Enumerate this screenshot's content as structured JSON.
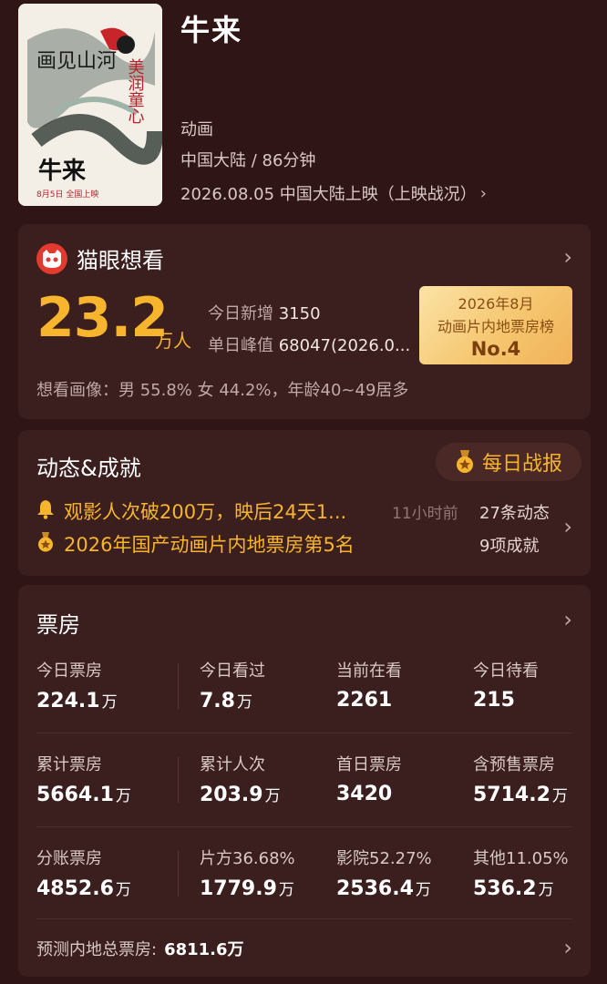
{
  "movie": {
    "title": "牛来",
    "genre": "动画",
    "region_duration": "中国大陆 / 86分钟",
    "release": "2026.08.05 中国大陆上映（上映战况）",
    "poster": {
      "calligraphy_left": "画见山河",
      "calligraphy_right": "美润童心",
      "title": "牛来",
      "date": "8月5日 全国上映"
    }
  },
  "want": {
    "title": "猫眼想看",
    "count": "23.2",
    "unit": "万人",
    "today_label": "今日新增",
    "today_value": "3150",
    "peak_label": "单日峰值",
    "peak_value": "68047(2026.0...",
    "rank": {
      "line1": "2026年8月",
      "line2": "动画片内地票房榜",
      "line3": "No.4"
    },
    "portrait": "想看画像：男 55.8%  女 44.2%，年龄40~49居多"
  },
  "dynamics": {
    "title": "动态&成就",
    "daily_button": "每日战报",
    "item1": "观影人次破200万，映后24天1...",
    "item1_time": "11小时前",
    "item1_count": "27条动态",
    "item2": "2026年国产动画片内地票房第5名",
    "item2_count": "9项成就"
  },
  "boxoffice": {
    "title": "票房",
    "rows": [
      [
        {
          "label": "今日票房",
          "value": "224.1",
          "unit": "万"
        },
        {
          "label": "今日看过",
          "value": "7.8",
          "unit": "万"
        },
        {
          "label": "当前在看",
          "value": "2261",
          "unit": ""
        },
        {
          "label": "今日待看",
          "value": "215",
          "unit": ""
        }
      ],
      [
        {
          "label": "累计票房",
          "value": "5664.1",
          "unit": "万"
        },
        {
          "label": "累计人次",
          "value": "203.9",
          "unit": "万"
        },
        {
          "label": "首日票房",
          "value": "3420",
          "unit": ""
        },
        {
          "label": "含预售票房",
          "value": "5714.2",
          "unit": "万"
        }
      ],
      [
        {
          "label": "分账票房",
          "value": "4852.6",
          "unit": "万"
        },
        {
          "label": "片方36.68%",
          "value": "1779.9",
          "unit": "万"
        },
        {
          "label": "影院52.27%",
          "value": "2536.4",
          "unit": "万"
        },
        {
          "label": "其他11.05%",
          "value": "536.2",
          "unit": "万"
        }
      ]
    ],
    "predict_label": "预测内地总票房:",
    "predict_value": "6811.6万"
  },
  "colors": {
    "background": "#2f1515",
    "card": "#3b1e1e",
    "accent_gold": "#f7b52e",
    "maoyan_red": "#e23a2e"
  },
  "icons": {
    "cat": "maoyan-cat-icon",
    "bell": "bell-icon",
    "medal": "medal-icon",
    "chevron": "chevron-right-icon"
  }
}
